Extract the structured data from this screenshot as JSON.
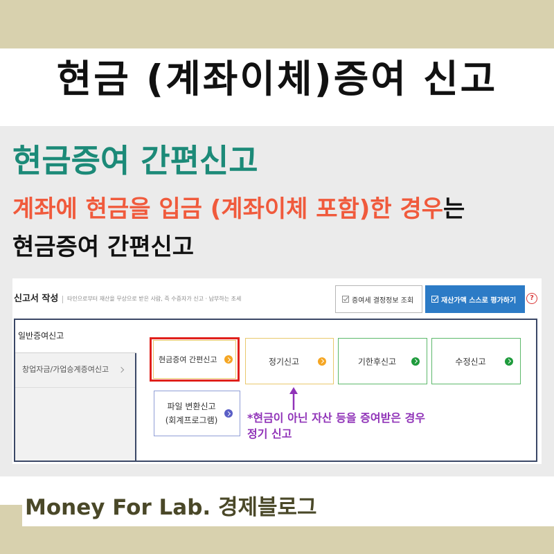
{
  "header": {
    "title": "현금 (계좌이체)증여 신고"
  },
  "intro": {
    "heading": "현금증여 간편신고",
    "condition_highlight": "계좌에 현금을 입금 (계좌이체 포함)한 경우",
    "condition_suffix": "는",
    "subheading": "현금증여 간편신고"
  },
  "screenshot": {
    "page_title": "신고서 작성",
    "page_desc": "타인으로부터 재산을 무상으로 받은 사람, 즉 수증자가 신고 · 납부하는 조세",
    "buttons": {
      "lookup": "증여세 결정정보 조회",
      "self_eval": "재산가액 스스로 평가하기",
      "help": "?",
      "icon": "checkbox-icon"
    },
    "sidebar": [
      {
        "label": "일반증여신고",
        "selected": true
      },
      {
        "label": "창업자금/가업승계증여신고",
        "icon": "chevron-right-icon"
      }
    ],
    "options": [
      {
        "label": "현금증여 간편신고",
        "icon": "arrow-right-circle-icon",
        "arrow_color": "#f5a623",
        "highlighted": true
      },
      {
        "label": "정기신고",
        "icon": "arrow-right-circle-icon",
        "arrow_color": "#f5a623"
      },
      {
        "label": "기한후신고",
        "icon": "arrow-right-circle-icon",
        "arrow_color": "#1e9b3c"
      },
      {
        "label": "수정신고",
        "icon": "arrow-right-circle-icon",
        "arrow_color": "#1e9b3c"
      },
      {
        "label_line1": "파일 변환신고",
        "label_line2": "(회계프로그램)",
        "icon": "arrow-right-circle-icon",
        "arrow_color": "#5a5fc6"
      }
    ],
    "annotation": {
      "line1": "*현금이 아닌 자산 등을 증여받은 경우",
      "line2": "정기 신고",
      "icon": "arrow-up-icon"
    }
  },
  "footer": {
    "brand": "Money For Lab. 경제블로그"
  },
  "colors": {
    "beige": "#d8d1ae",
    "panel_bg": "#ebebeb",
    "teal": "#1c8a78",
    "condition": "#f05a3c",
    "annotation": "#9033b8",
    "highlight": "#e0201b",
    "primary_button": "#2c7bc6",
    "panel_border": "#3a4766",
    "brand": "#4a4828"
  }
}
